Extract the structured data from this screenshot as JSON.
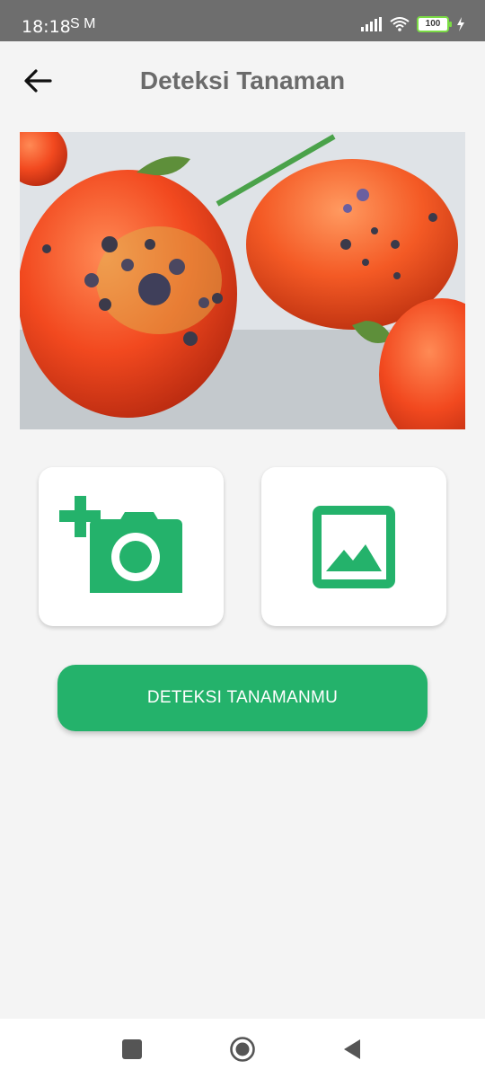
{
  "status_bar": {
    "time": "18:18",
    "left_icons": "S M",
    "battery": "100"
  },
  "header": {
    "title": "Deteksi Tanaman"
  },
  "image": {
    "alt": "Tomato with dark spots"
  },
  "actions": {
    "camera_icon": "add-photo-camera-icon",
    "gallery_icon": "image-gallery-icon",
    "accent_color": "#24b26b"
  },
  "detect_button": {
    "label": "DETEKSI TANAMANMU"
  },
  "nav": {
    "recent": "square-icon",
    "home": "circle-icon",
    "back": "triangle-back-icon"
  }
}
